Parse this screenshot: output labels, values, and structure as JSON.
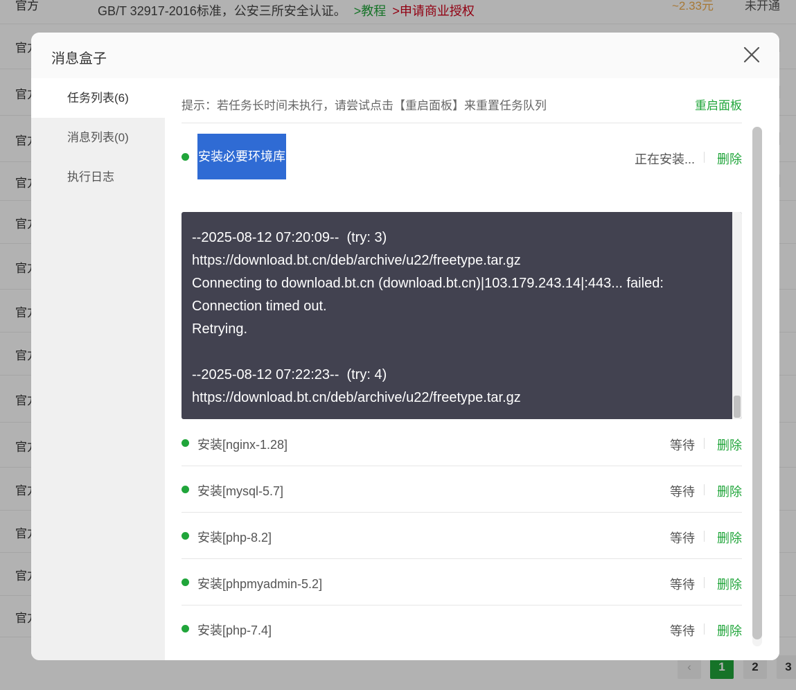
{
  "background": {
    "top_row": {
      "col1": "官方",
      "desc": "GB/T 32917-2016标准，公安三所安全认证。",
      "link_tutorial": ">教程",
      "link_license": ">申请商业授权",
      "price": "~2.33元",
      "state": "未开通"
    },
    "row_label": "官方",
    "pager": [
      "1",
      "2",
      "3"
    ]
  },
  "modal": {
    "title": "消息盒子",
    "sidebar": {
      "items": [
        {
          "label": "任务列表(6)",
          "active": true
        },
        {
          "label": "消息列表(0)",
          "active": false
        },
        {
          "label": "执行日志",
          "active": false
        }
      ]
    },
    "tip": {
      "text": "提示：若任务长时间未执行，请尝试点击【重启面板】来重置任务队列",
      "restart_label": "重启面板"
    },
    "current_task": {
      "name": "安装必要环境库",
      "status": "正在安装...",
      "delete_label": "删除"
    },
    "log_lines": [
      "--2025-08-12 07:20:09--  (try: 3)",
      "https://download.bt.cn/deb/archive/u22/freetype.tar.gz",
      "Connecting to download.bt.cn (download.bt.cn)|103.179.243.14|:443... failed:",
      "Connection timed out.",
      "Retrying.",
      "",
      "--2025-08-12 07:22:23--  (try: 4)",
      "https://download.bt.cn/deb/archive/u22/freetype.tar.gz"
    ],
    "tasks": [
      {
        "name": "安装[nginx-1.28]",
        "status": "等待",
        "delete_label": "删除"
      },
      {
        "name": "安装[mysql-5.7]",
        "status": "等待",
        "delete_label": "删除"
      },
      {
        "name": "安装[php-8.2]",
        "status": "等待",
        "delete_label": "删除"
      },
      {
        "name": "安装[phpmyadmin-5.2]",
        "status": "等待",
        "delete_label": "删除"
      },
      {
        "name": "安装[php-7.4]",
        "status": "等待",
        "delete_label": "删除"
      }
    ],
    "colors": {
      "accent_green": "#20a53a",
      "selection_blue": "#2f6bd4",
      "log_background": "#424250",
      "status_dot": "#20a53a"
    }
  }
}
